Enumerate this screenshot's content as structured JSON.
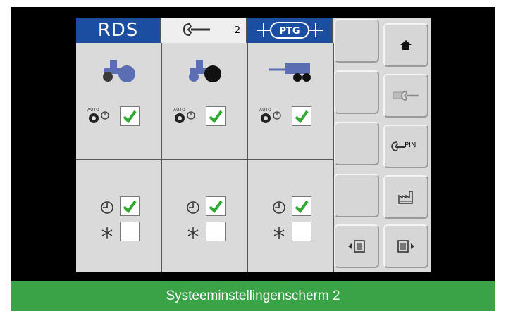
{
  "header": {
    "rds_label": "RDS",
    "wrench_number": "2",
    "ptg_logo_text": "PTG"
  },
  "columns": [
    {
      "device_icon": "tractor-icon",
      "auto_checked": true,
      "timer_checked": true,
      "frost_checked": false
    },
    {
      "device_icon": "tractor-icon",
      "auto_checked": true,
      "timer_checked": true,
      "frost_checked": false
    },
    {
      "device_icon": "trailer-icon",
      "auto_checked": true,
      "timer_checked": true,
      "frost_checked": false
    }
  ],
  "side_buttons": {
    "pin_label": "PIN",
    "icons": [
      "blank",
      "home-icon",
      "blank",
      "wrench-settings-icon",
      "blank",
      "wrench-pin-icon",
      "blank",
      "factory-icon",
      "previous-screen-icon",
      "next-screen-icon"
    ]
  },
  "caption": "Systeeminstellingenscherm 2",
  "colors": {
    "brand_blue": "#1b4da0",
    "caption_green": "#3aa348",
    "check_green": "#2fa82f",
    "icon_blue": "#5b6eb3"
  }
}
